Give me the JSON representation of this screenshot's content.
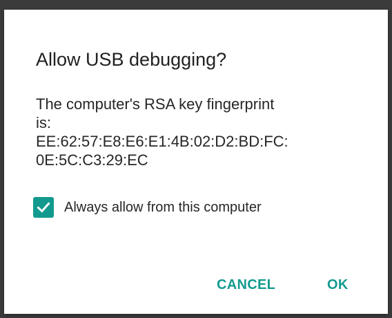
{
  "dialog": {
    "title": "Allow USB debugging?",
    "message_lines": [
      "The computer's RSA key fingerprint",
      "is:",
      "EE:62:57:E8:E6:E1:4B:02:D2:BD:FC:",
      "0E:5C:C3:29:EC"
    ],
    "checkbox": {
      "label": "Always allow from this computer",
      "checked": true
    },
    "buttons": {
      "cancel_label": "CANCEL",
      "ok_label": "OK"
    }
  },
  "colors": {
    "accent": "#139a8e",
    "dialog_background": "#ffffff",
    "scrim": "#3b3b3b"
  },
  "icons": {
    "checkbox_icon": "checkmark-icon"
  }
}
